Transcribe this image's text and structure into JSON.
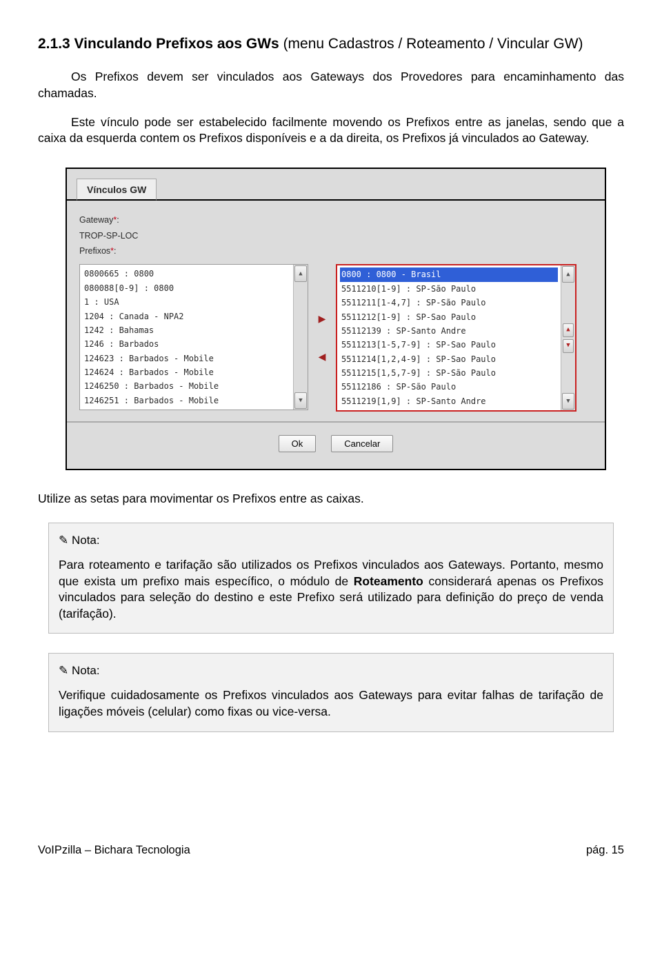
{
  "heading_number": "2.1.3 Vinculando Prefixos aos GWs",
  "heading_thin": " (menu Cadastros / Roteamento / Vincular GW)",
  "para1": "Os Prefixos devem ser vinculados aos Gateways dos Provedores para encaminhamento das chamadas.",
  "para2": "Este vínculo pode ser estabelecido facilmente movendo os Prefixos entre as janelas, sendo que a caixa da esquerda contem os Prefixos disponíveis e a da direita, os Prefixos já vinculados ao Gateway.",
  "ui": {
    "tab": "Vínculos GW",
    "gw_label": "Gateway",
    "gw_value": "TROP-SP-LOC",
    "pref_label": "Prefixos",
    "left_items": [
      "0800665 : 0800",
      "080088[0-9] : 0800",
      "1 : USA",
      "1204 : Canada - NPA2",
      "1242 : Bahamas",
      "1246 : Barbados",
      "124623 : Barbados - Mobile",
      "124624 : Barbados - Mobile",
      "1246250 : Barbados - Mobile",
      "1246251 : Barbados - Mobile"
    ],
    "right_items": [
      "0800 : 0800 - Brasil",
      "5511210[1-9] : SP-São Paulo",
      "5511211[1-4,7] : SP-São Paulo",
      "5511212[1-9] : SP-Sao Paulo",
      "55112139 : SP-Santo Andre",
      "5511213[1-5,7-9] : SP-Sao Paulo",
      "5511214[1,2,4-9] : SP-Sao Paulo",
      "5511215[1,5,7-9] : SP-São Paulo",
      "55112186 : SP-São Paulo",
      "5511219[1,9] : SP-Santo Andre"
    ],
    "ok": "Ok",
    "cancel": "Cancelar"
  },
  "post_shot": "Utilize as setas para movimentar os Prefixos entre as caixas.",
  "note_label": "Nota:",
  "note1": "Para roteamento e tarifação são utilizados os Prefixos vinculados aos Gateways. Portanto, mesmo que exista um prefixo mais específico, o módulo de Roteamento considerará apenas os Prefixos vinculados para seleção do destino e este Prefixo será utilizado para definição do preço de venda (tarifação).",
  "note2": "Verifique cuidadosamente os Prefixos vinculados aos Gateways para evitar falhas de tarifação de ligações móveis (celular) como fixas ou vice-versa.",
  "footer_left": "VoIPzilla – Bichara Tecnologia",
  "footer_right": "pág. 15"
}
